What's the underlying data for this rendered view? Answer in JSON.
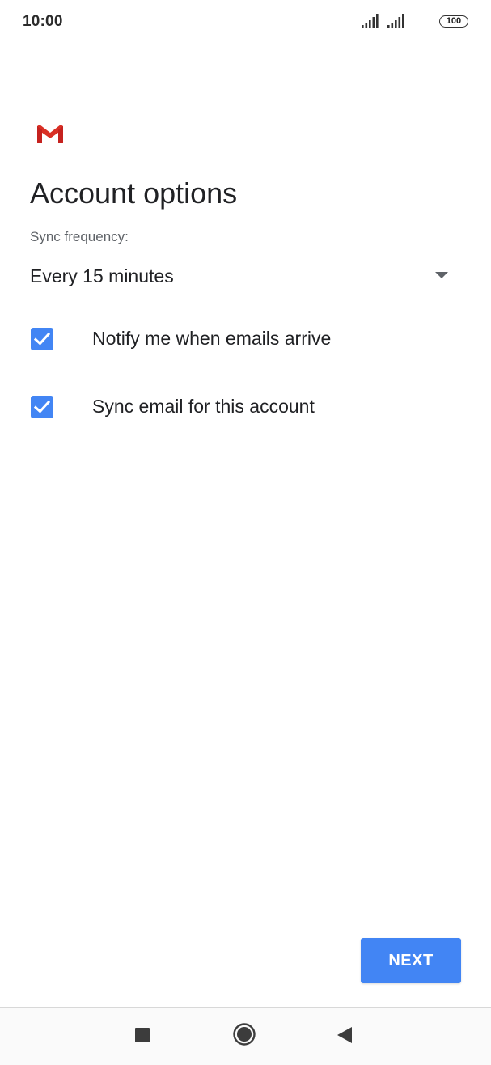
{
  "status_bar": {
    "time": "10:00",
    "battery": "100"
  },
  "header": {
    "title": "Account options"
  },
  "sync": {
    "label": "Sync frequency:",
    "selected_value": "Every 15 minutes"
  },
  "options": [
    {
      "label": "Notify me when emails arrive",
      "checked": true
    },
    {
      "label": "Sync email for this account",
      "checked": true
    }
  ],
  "actions": {
    "next_label": "NEXT"
  },
  "colors": {
    "accent": "#4285f4",
    "gmail_red": "#d93025"
  },
  "icons": {
    "logo": "gmail-logo-icon",
    "dropdown": "dropdown-arrow-icon",
    "checkbox": "checkbox-checked-icon",
    "nav_recents": "square-icon",
    "nav_home": "circle-home-icon",
    "nav_back": "triangle-back-icon"
  }
}
